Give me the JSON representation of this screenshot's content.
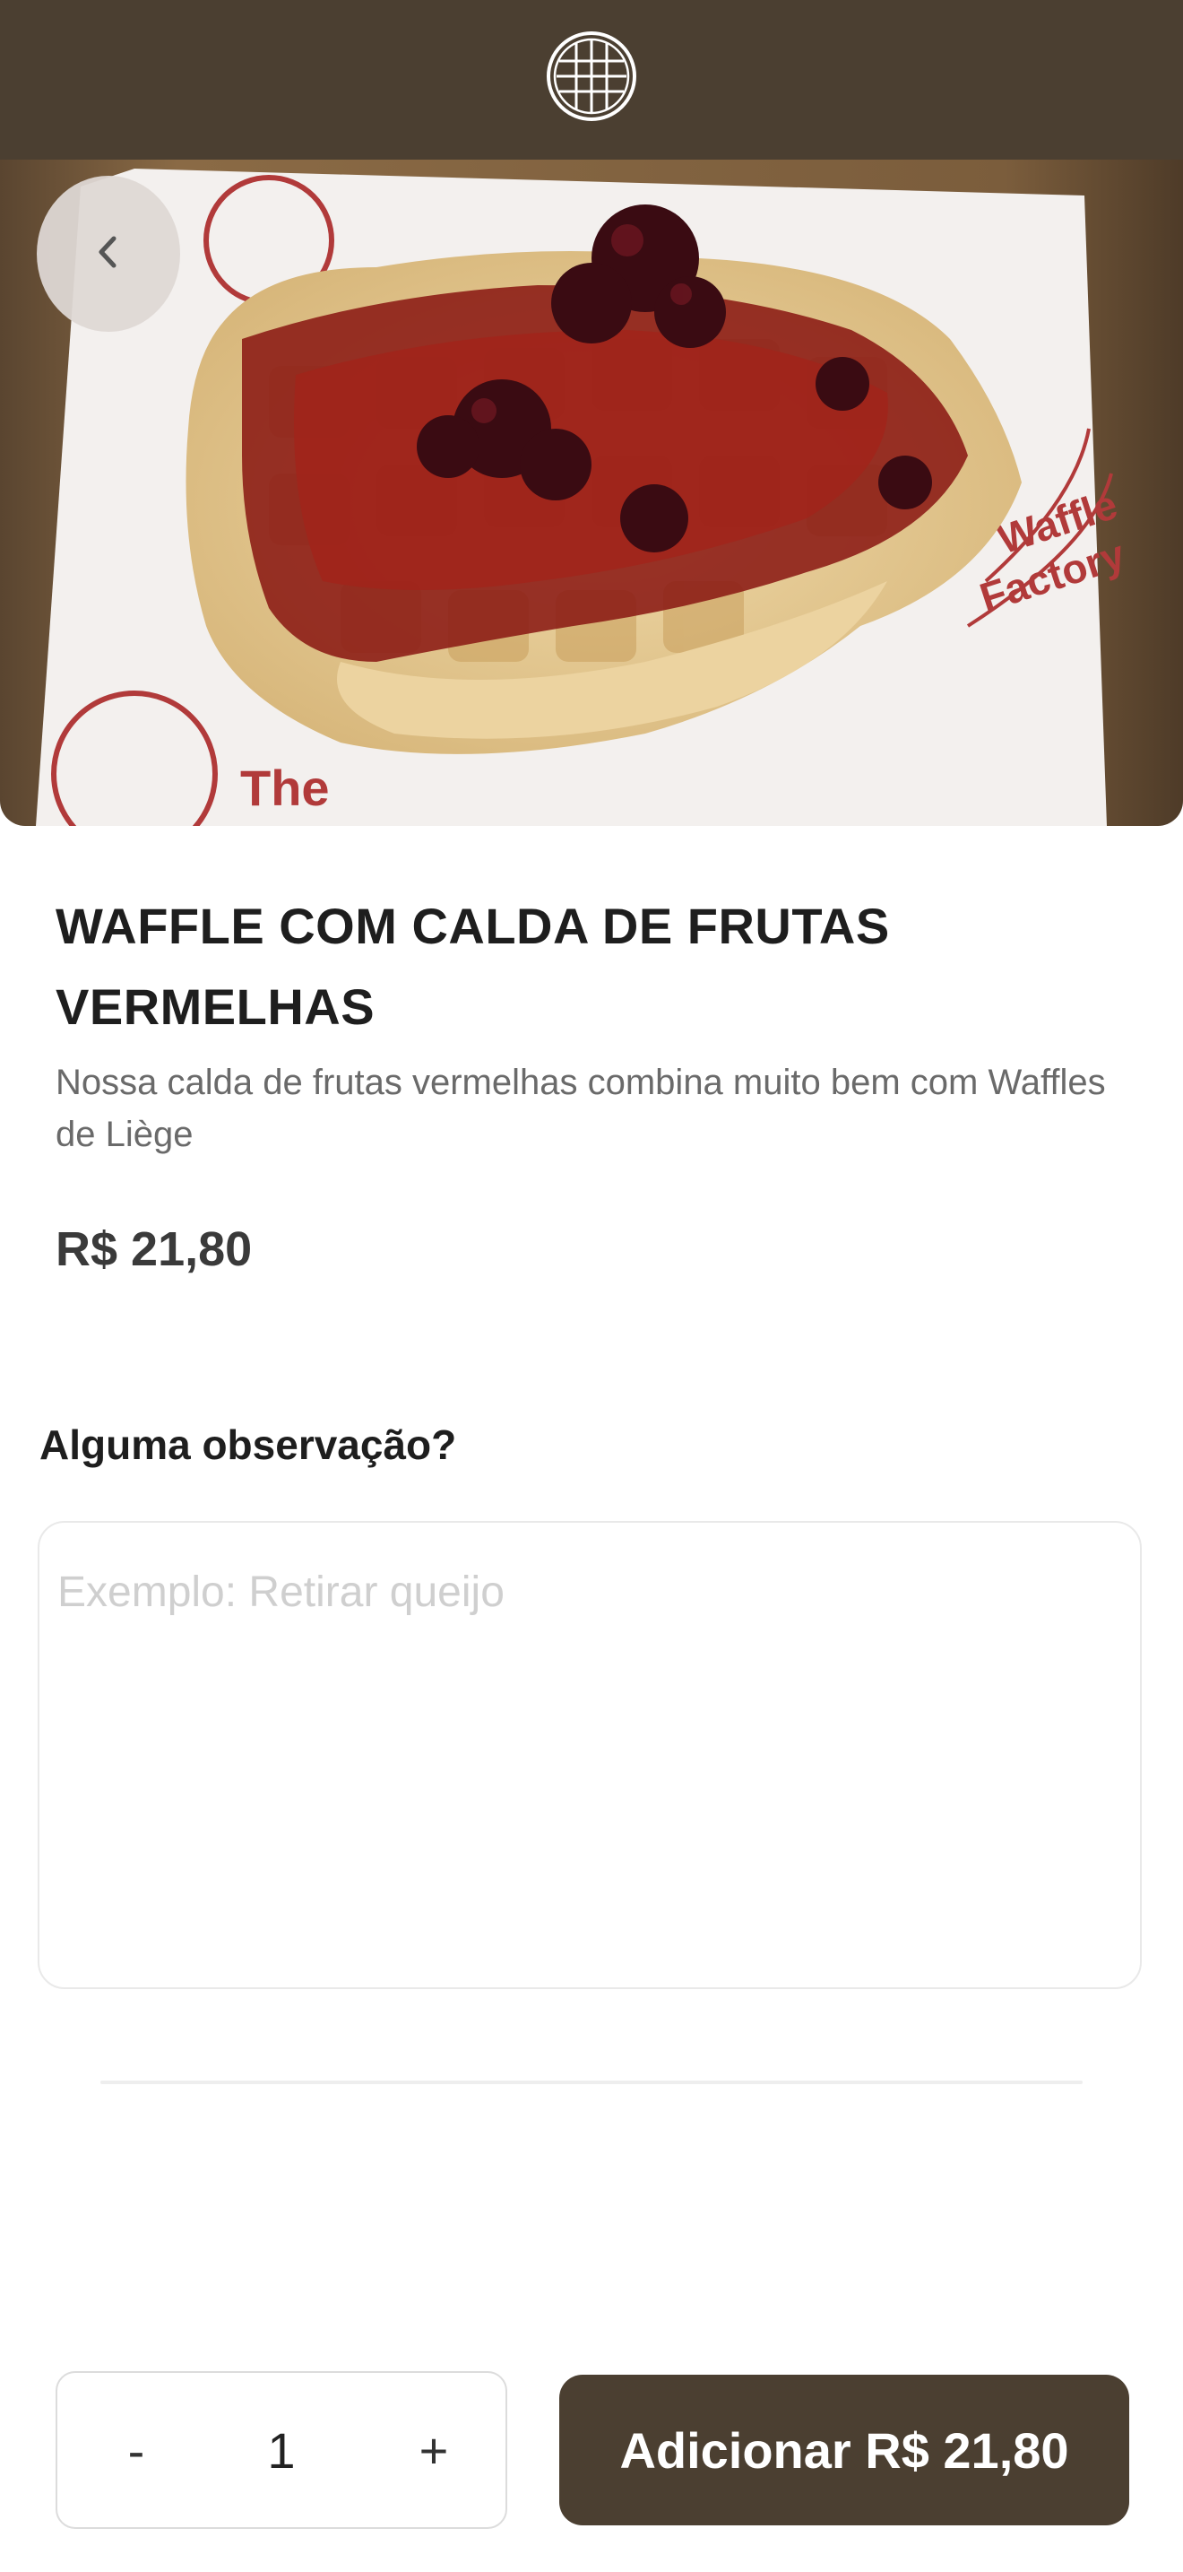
{
  "header": {
    "logo_icon": "waffle-logo-icon",
    "bar_color": "#4b3f31"
  },
  "hero": {
    "image_subject": "waffle-with-red-berry-syrup",
    "back_icon": "chevron-left-icon",
    "wrapper_text_1": "The",
    "wrapper_text_2": "Waffle",
    "wrapper_text_3": "Factory"
  },
  "product": {
    "title": "WAFFLE COM CALDA DE FRUTAS VERMELHAS",
    "description": "Nossa calda de frutas vermelhas combina muito bem com Waffles de Liège",
    "price": "R$ 21,80"
  },
  "notes": {
    "label": "Alguma observação?",
    "placeholder": "Exemplo: Retirar queijo",
    "value": ""
  },
  "quantity": {
    "minus_label": "-",
    "value": "1",
    "plus_label": "+"
  },
  "add_button": {
    "label": "Adicionar R$ 21,80",
    "color": "#4b3f31"
  }
}
